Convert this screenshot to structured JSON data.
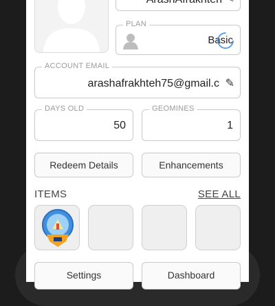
{
  "profile": {
    "username": "ArashAfrakhteh",
    "plan_label": "PLAN",
    "plan_value": "Basic",
    "email_label": "ACCOUNT EMAIL",
    "email_value": "arashafrakhteh75@gmail.c",
    "days_old_label": "DAYS OLD",
    "days_old_value": "50",
    "geomines_label": "GEOMINES",
    "geomines_value": "1"
  },
  "buttons": {
    "redeem": "Redeem Details",
    "enhancements": "Enhancements",
    "settings": "Settings",
    "dashboard": "Dashboard"
  },
  "items": {
    "title": "ITEMS",
    "see_all": "SEE ALL",
    "tiles": [
      {
        "icon": "badge-icon"
      },
      {
        "icon": "empty"
      },
      {
        "icon": "empty"
      },
      {
        "icon": "empty"
      }
    ]
  },
  "colors": {
    "background": "#1c1c1c",
    "panel": "#ffffff",
    "border": "#c9c9c9",
    "label": "#9a9a9a",
    "badge_blue": "#3f8fe0",
    "badge_orange": "#f2a321"
  }
}
